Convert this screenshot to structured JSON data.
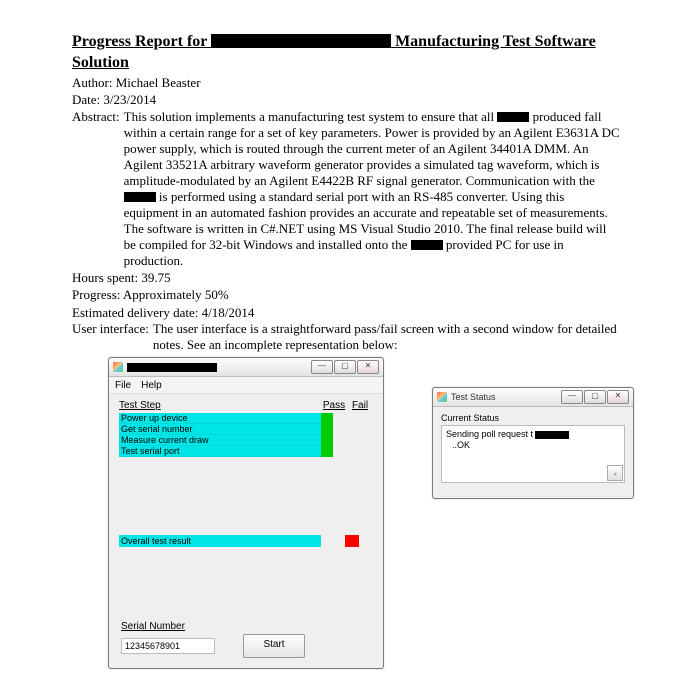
{
  "title": {
    "pre": "Progress Report for",
    "post": "Manufacturing  Test Software Solution"
  },
  "author_label": "Author: ",
  "author": "Michael Beaster",
  "date_label": "Date: ",
  "date": "3/23/2014",
  "abstract_label": "Abstract: ",
  "abstract": {
    "p1": "This solution implements a manufacturing test system to ensure that all ",
    "p2": " produced fall within a certain range for a set of key parameters. Power is provided by an Agilent E3631A DC power supply, which is routed through the current meter of an Agilent 34401A DMM. An Agilent 33521A arbitrary waveform generator provides a simulated tag waveform, which is amplitude-modulated by an Agilent E4422B RF signal generator. Communication with the ",
    "p3": " is performed using a standard serial port with an RS-485 converter. Using this equipment in an automated fashion provides an accurate and repeatable set of measurements. The software is written in C#.NET using MS Visual Studio 2010. The final release build will be compiled for 32-bit Windows and installed onto the ",
    "p4": " provided PC for use in production."
  },
  "hours_label": "Hours spent: ",
  "hours": "39.75",
  "progress_label": "Progress: ",
  "progress": "Approximately 50%",
  "deliv_label": "Estimated delivery date: ",
  "deliv": "4/18/2014",
  "ui_label": "User interface: ",
  "ui_text": "The user interface is a straightforward pass/fail screen with a second window for detailed notes. See an incomplete representation below:",
  "main_window": {
    "menu_file": "File",
    "menu_help": "Help",
    "col_step": "Test Step",
    "col_pass": "Pass",
    "col_fail": "Fail",
    "steps": {
      "s0": "Power up device",
      "s1": "Get serial number",
      "s2": "Measure current draw",
      "s3": "Test serial port"
    },
    "overall": "Overall test result",
    "serial_label": "Serial Number",
    "serial_value": "12345678901",
    "start": "Start"
  },
  "status_window": {
    "title": "Test Status",
    "label": "Current Status",
    "line1_pre": "Sending poll request t",
    "line2": "..OK"
  },
  "winbtns": {
    "min": "—",
    "max": "▢",
    "close": "✕"
  }
}
